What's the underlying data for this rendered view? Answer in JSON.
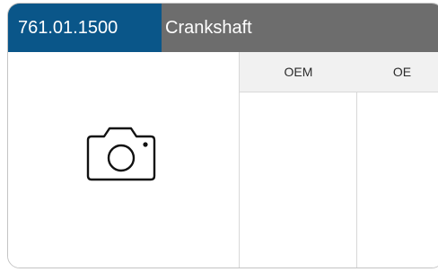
{
  "header": {
    "part_number": "761.01.1500",
    "part_name": "Crankshaft"
  },
  "image": {
    "placeholder_icon": "camera-icon"
  },
  "table": {
    "columns": [
      "OEM",
      "OE"
    ]
  },
  "colors": {
    "part_number_bg": "#0a5689",
    "header_bg": "#6d6d6d",
    "column_header_bg": "#f1f1f1",
    "border": "#c4c4c4"
  }
}
